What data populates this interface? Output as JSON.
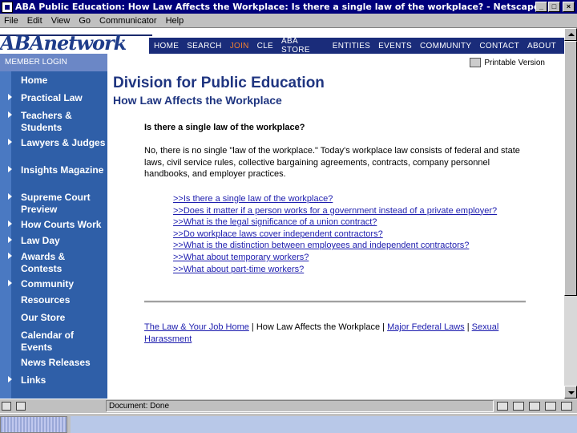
{
  "window": {
    "title": "ABA Public Education: How Law Affects the Workplace: Is there a single law of the workplace? - Netscape",
    "buttons": {
      "minimize": "_",
      "maximize": "□",
      "close": "×"
    }
  },
  "menubar": [
    "File",
    "Edit",
    "View",
    "Go",
    "Communicator",
    "Help"
  ],
  "banner": {
    "logo": "ABAnetwork",
    "nav": [
      "HOME",
      "SEARCH",
      "JOIN",
      "CLE",
      "ABA STORE",
      "ENTITIES",
      "EVENTS",
      "COMMUNITY",
      "CONTACT",
      "ABOUT"
    ]
  },
  "member_login": "MEMBER LOGIN",
  "sidebar": {
    "items": [
      {
        "label": "Home",
        "arrow": false
      },
      {
        "label": "Practical Law",
        "arrow": true
      },
      {
        "label": "Teachers & Students",
        "arrow": true
      },
      {
        "label": "Lawyers & Judges",
        "arrow": true
      },
      {
        "label": "Insights Magazine",
        "arrow": true
      },
      {
        "label": "Supreme Court Preview",
        "arrow": true
      },
      {
        "label": "How Courts Work",
        "arrow": true
      },
      {
        "label": "Law Day",
        "arrow": true
      },
      {
        "label": "Awards & Contests",
        "arrow": true
      },
      {
        "label": "Community",
        "arrow": true
      },
      {
        "label": "Resources",
        "arrow": false
      },
      {
        "label": "Our Store",
        "arrow": false
      },
      {
        "label": "Calendar of Events",
        "arrow": false
      },
      {
        "label": "News Releases",
        "arrow": false
      },
      {
        "label": "Links",
        "arrow": true
      }
    ]
  },
  "content": {
    "printable": "Printable Version",
    "title": "Division for Public Education",
    "subtitle": "How Law Affects the Workplace",
    "question": "Is there a single law of the workplace?",
    "answer": "No, there is no single \"law of the workplace.\" Today's workplace law consists of federal and state laws, civil service rules, collective bargaining agreements, contracts, company personnel handbooks, and employer practices.",
    "question_links": [
      ">>Is there a single law of the workplace?",
      ">>Does it matter if a person works for a government instead of a private employer?",
      ">>What is the legal significance of a union contract?",
      ">>Do workplace laws cover independent contractors?",
      ">>What is the distinction between employees and independent contractors?",
      ">>What about temporary workers?",
      ">>What about part-time workers?"
    ],
    "footer": {
      "link1": "The Law & Your Job Home",
      "sep1": " | How Law Affects the Workplace | ",
      "link2": "Major Federal Laws",
      "sep2": " | ",
      "link3": "Sexual Harassment"
    }
  },
  "statusbar": {
    "text": "Document: Done"
  },
  "colors": {
    "titlebar": "#00007b",
    "sidebar": "#2f5fa8",
    "heading": "#1f3580",
    "link": "#1c1cae"
  }
}
